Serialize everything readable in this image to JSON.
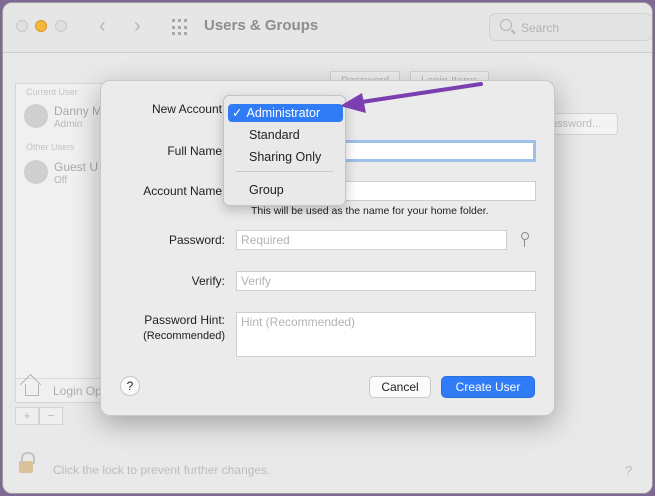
{
  "window": {
    "title": "Users & Groups",
    "search_placeholder": "Search"
  },
  "background": {
    "sidebar_heading_current": "Current User",
    "sidebar_heading_other": "Other Users",
    "users": [
      {
        "name": "Danny M",
        "role": "Admin"
      },
      {
        "name": "Guest U",
        "role": "Off"
      }
    ],
    "login_options": "Login Op",
    "tabs": [
      "Password",
      "Login Items"
    ],
    "change_password": "assword...",
    "add": "+",
    "remove": "−",
    "lock_text": "Click the lock to prevent further changes.",
    "help": "?"
  },
  "dialog": {
    "new_account_label": "New Account",
    "full_name_label": "Full Name",
    "account_name_label": "Account Name",
    "account_name_hint": "This will be used as the name for your home folder.",
    "password_label": "Password:",
    "password_placeholder": "Required",
    "verify_label": "Verify:",
    "verify_placeholder": "Verify",
    "password_hint_label": "Password Hint:",
    "password_hint_sublabel": "(Recommended)",
    "password_hint_placeholder": "Hint (Recommended)",
    "help": "?",
    "cancel": "Cancel",
    "create_user": "Create User"
  },
  "dropdown": {
    "check": "✓",
    "items": [
      "Administrator",
      "Standard",
      "Sharing Only",
      "Group"
    ],
    "selected": "Administrator"
  },
  "colors": {
    "accent": "#2f7cf6",
    "annotation_arrow": "#7b3fb0"
  },
  "icons": [
    "search-icon",
    "grid-icon",
    "back-icon",
    "forward-icon",
    "key-icon",
    "home-icon",
    "lock-icon"
  ]
}
